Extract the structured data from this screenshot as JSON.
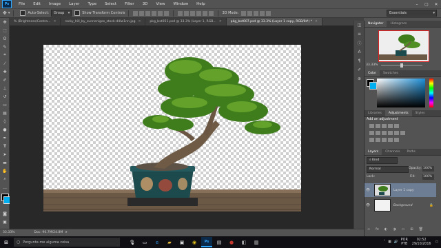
{
  "menu": {
    "logo": "Ps",
    "items": [
      "File",
      "Edit",
      "Image",
      "Layer",
      "Type",
      "Select",
      "Filter",
      "3D",
      "View",
      "Window",
      "Help"
    ]
  },
  "options": {
    "auto_select_label": "Auto-Select:",
    "auto_select_value": "Group",
    "show_transform_label": "Show Transform Controls",
    "mode_label": "3D Mode:",
    "workspace_value": "Essentials"
  },
  "tabs": [
    {
      "label": "% (Brightness/Contra...",
      "active": false
    },
    {
      "label": "rocky_hill_by_sunnenigos_stock-d4lw1nn.jpg",
      "active": false
    },
    {
      "label": "pkg_bxt051.psd @ 33.3% (Layer 1, RGB...",
      "active": false
    },
    {
      "label": "pkg_bxt007.psd @ 33.3% (Layer 1 copy, RGB/8#) *",
      "active": true
    }
  ],
  "status": {
    "zoom": "33.33%",
    "doc": "Doc: 90.7M/24.8M"
  },
  "navigator": {
    "tabs": [
      "Navigator",
      "Histogram"
    ],
    "zoom": "33.33%"
  },
  "color_panel": {
    "tabs": [
      "Color",
      "Swatches"
    ]
  },
  "adjustments": {
    "tabs": [
      "Libraries",
      "Adjustments",
      "Styles"
    ],
    "heading": "Add an adjustment"
  },
  "layers": {
    "tabs": [
      "Layers",
      "Channels",
      "Paths"
    ],
    "kind": "Kind",
    "blend_mode": "Normal",
    "opacity_label": "Opacity:",
    "opacity_value": "100%",
    "lock_label": "Lock:",
    "fill_label": "Fill:",
    "fill_value": "100%",
    "items": [
      {
        "name": "Layer 1 copy",
        "selected": true
      },
      {
        "name": "Background",
        "selected": false
      }
    ]
  },
  "taskbar": {
    "search_placeholder": "Pergunte-me alguma coisa",
    "lang": "POR",
    "layout": "PTB",
    "time": "02:52",
    "date": "29/10/2016"
  },
  "colors": {
    "accent": "#31a8ff",
    "canvas_bg": "#282828",
    "ui_bg": "#535353"
  }
}
